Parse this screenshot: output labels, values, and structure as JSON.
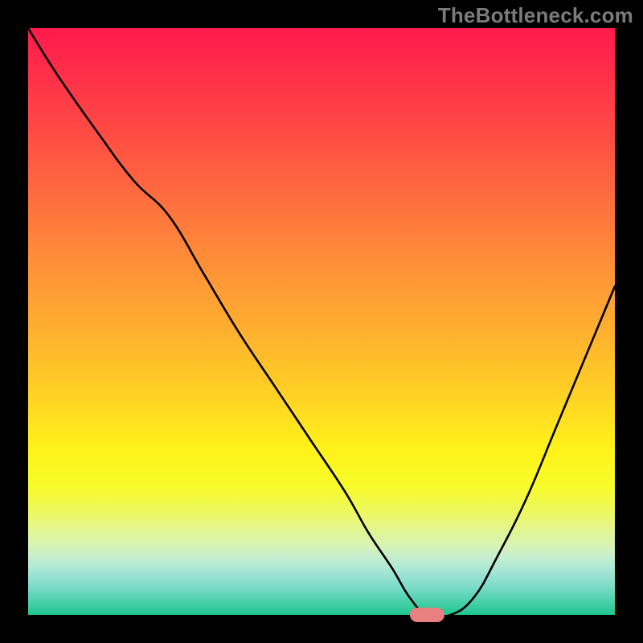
{
  "watermark": "TheBottleneck.com",
  "colors": {
    "frame_bg": "#000000",
    "curve_stroke": "#000000",
    "marker_fill": "#e98080"
  },
  "chart_data": {
    "type": "line",
    "title": "",
    "xlabel": "",
    "ylabel": "",
    "xlim": [
      0,
      100
    ],
    "ylim": [
      0,
      100
    ],
    "grid": false,
    "legend": false,
    "series": [
      {
        "name": "bottleneck-curve",
        "x": [
          0,
          5,
          12,
          18,
          24,
          30,
          36,
          42,
          48,
          54,
          58,
          62,
          65,
          68,
          72,
          76,
          80,
          85,
          90,
          95,
          100
        ],
        "values": [
          100,
          92,
          82,
          74,
          68,
          58,
          48,
          39,
          30,
          21,
          14,
          8,
          3,
          0,
          0,
          3,
          10,
          20,
          32,
          44,
          56
        ]
      }
    ],
    "marker": {
      "x": 68,
      "y": 0,
      "width_units": 6
    },
    "background_gradient": {
      "top_color": "#ff1a4d",
      "bottom_color": "#1ec78e",
      "description": "vertical red→orange→yellow→green heat gradient"
    }
  }
}
